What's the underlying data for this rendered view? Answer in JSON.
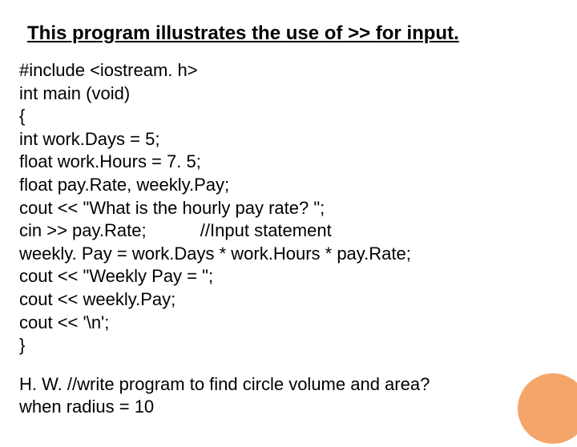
{
  "title": "This program illustrates the use of >> for input.",
  "code": {
    "l0": "#include <iostream. h>",
    "l1": "int main (void)",
    "l2": "{",
    "l3": "int work.Days = 5;",
    "l4": "float work.Hours = 7. 5;",
    "l5": "float pay.Rate, weekly.Pay;",
    "l6": "cout << \"What is the hourly pay rate? \";",
    "l7": "cin >> pay.Rate;           //Input statement",
    "l8": "weekly. Pay = work.Days * work.Hours * pay.Rate;",
    "l9": "cout << \"Weekly Pay = \";",
    "l10": "cout << weekly.Pay;",
    "l11": "cout << '\\n';",
    "l12": "}"
  },
  "hw": {
    "line1": "H. W. //write program to find circle volume and area?",
    "line2": "when radius = 10"
  }
}
